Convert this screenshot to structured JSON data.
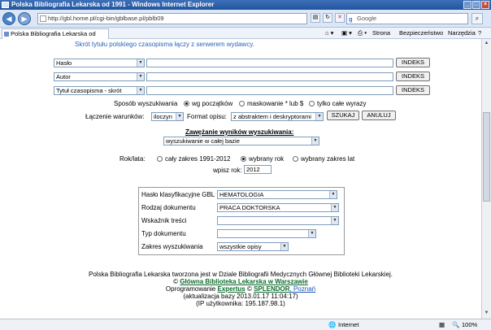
{
  "window": {
    "title": "Polska Bibliografia Lekarska od 1991 - Windows Internet Explorer"
  },
  "browser": {
    "url": "http://gbl.home.pl/cgi-bin/gblbase.pl/pblb09",
    "search_placeholder": "Google",
    "tab_label": "Polska Bibliografia Lekarska od 1991",
    "commands": {
      "page": "Strona",
      "security": "Bezpieczeństwo",
      "tools": "Narzędzia"
    }
  },
  "page": {
    "tagline": "Skrót tytułu polskiego czasopisma łączy z serwerem wydawcy.",
    "search_rows": [
      {
        "field": "Hasło",
        "button": "INDEKS"
      },
      {
        "field": "Autor",
        "button": "INDEKS"
      },
      {
        "field": "Tytuł czasopisma - skrót",
        "button": "INDEKS"
      }
    ],
    "mode": {
      "label": "Sposób wyszukiwania",
      "options": [
        "wg początków",
        "maskowanie * lub $",
        "tylko całe wyrazy"
      ],
      "selected": 0
    },
    "join": {
      "label": "Łączenie warunków:",
      "value": "iloczyn"
    },
    "format": {
      "label": "Format opisu:",
      "value": "z abstraktem i deskryptorami"
    },
    "search_button": "SZUKAJ",
    "cancel_button": "ANULUJ",
    "narrow": {
      "heading": "Zawężanie wyników wyszukiwania:",
      "scope": "wyszukiwanie w całej bazie"
    },
    "year": {
      "label": "Rok/lata:",
      "options": [
        "cały zakres 1991-2012",
        "wybrany rok",
        "wybrany zakres lat"
      ],
      "selected": 1,
      "input_label": "wpisz rok:",
      "input_value": "2012"
    },
    "filters": [
      {
        "label": "Hasło klasyfikacyjne GBL",
        "value": "HEMATOLOGIA"
      },
      {
        "label": "Rodzaj dokumentu",
        "value": "PRACA DOKTORSKA"
      },
      {
        "label": "Wskaźnik treści",
        "value": ""
      },
      {
        "label": "Typ dokumentu",
        "value": ""
      },
      {
        "label": "Zakres wyszukiwania",
        "value": "wszystkie opisy"
      }
    ],
    "footer": {
      "line1": "Polska Bibliografia Lekarska tworzona jest w Dziale Bibliografii Medycznych Głównej Biblioteki Lekarskiej.",
      "line2_prefix": "© ",
      "line2_link": "Główna Biblioteka Lekarska w Warszawie",
      "line3_prefix": "Oprogramowanie ",
      "line3_link1": "Expertus",
      "line3_mid": " © ",
      "line3_link2": "SPLENDOR",
      "line3_suffix": ", Poznań",
      "line4": "(aktualizacja bazy 2013.01.17 11:04:17)",
      "line5": "(IP użytkownika: 195.187.98.1)"
    }
  },
  "status": {
    "zone": "Internet",
    "zoom": "100%"
  }
}
